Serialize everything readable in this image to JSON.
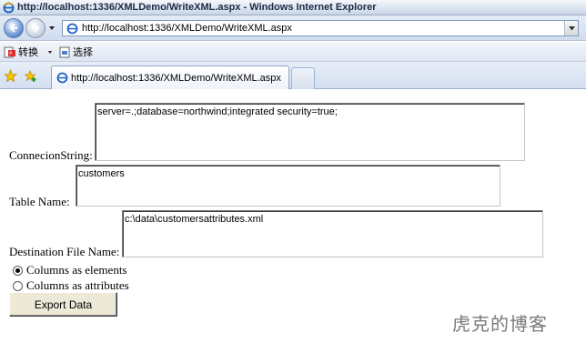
{
  "window": {
    "title": "http://localhost:1336/XMLDemo/WriteXML.aspx - Windows Internet Explorer"
  },
  "address_bar": {
    "url": "http://localhost:1336/XMLDemo/WriteXML.aspx"
  },
  "toolbar": {
    "convert_label": "转换",
    "select_label": "选择"
  },
  "tabs": [
    {
      "label": "http://localhost:1336/XMLDemo/WriteXML.aspx"
    }
  ],
  "form": {
    "connection_label": "ConnecionString:",
    "connection_value": "server=.;database=northwind;integrated security=true;",
    "table_label": "Table Name:",
    "table_value": "customers",
    "dest_label": "Destination File Name:",
    "dest_value": "c:\\data\\customersattributes.xml",
    "options": [
      {
        "label": "Columns as elements",
        "checked": true
      },
      {
        "label": "Columns as attributes",
        "checked": false
      }
    ],
    "export_button": "Export Data"
  },
  "watermark": "虎克的博客",
  "icons": {
    "back": "back-arrow-icon",
    "forward": "forward-arrow-icon",
    "page": "ie-page-icon",
    "favorites": "favorites-star-icon",
    "add_favorites": "add-favorites-icon"
  }
}
